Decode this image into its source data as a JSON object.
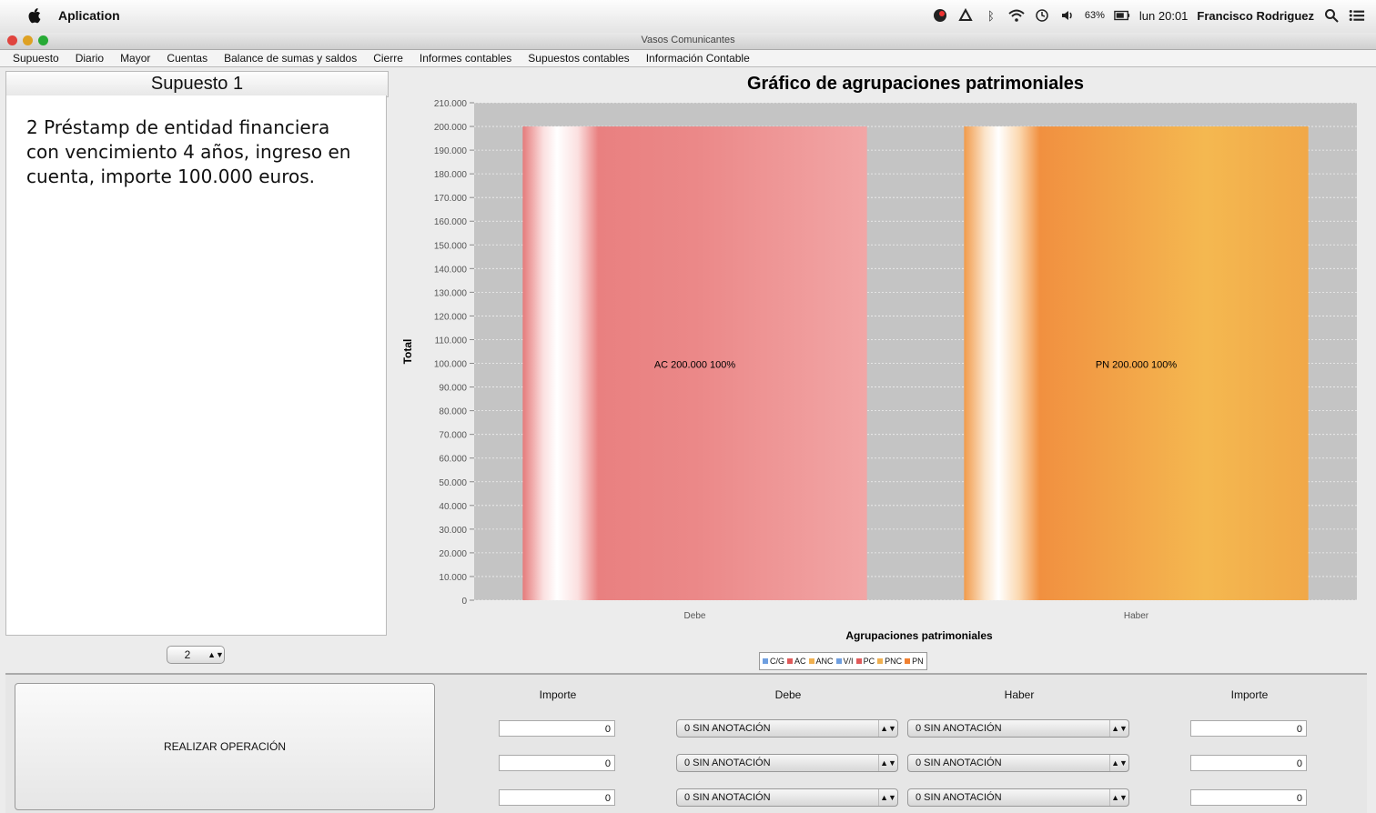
{
  "menubar": {
    "app_name": "Aplication",
    "battery": "63%",
    "clock": "lun 20:01",
    "user": "Francisco Rodriguez"
  },
  "window": {
    "title": "Vasos Comunicantes"
  },
  "menu": [
    "Supuesto",
    "Diario",
    "Mayor",
    "Cuentas",
    "Balance de sumas y saldos",
    "Cierre",
    "Informes contables",
    "Supuestos contables",
    "Información Contable"
  ],
  "left_panel": {
    "title": "Supuesto 1",
    "text": "2 Préstamp de entidad financiera con vencimiento 4  años, ingreso en cuenta, importe 100.000 euros.",
    "stepper_value": "2"
  },
  "chart_data": {
    "type": "bar",
    "title": "Gráfico de agrupaciones patrimoniales",
    "xlabel": "Agrupaciones patrimoniales",
    "ylabel": "Total",
    "categories": [
      "Debe",
      "Haber"
    ],
    "ylim": [
      0,
      210000
    ],
    "ytick_labels": [
      "0",
      "10.000",
      "20.000",
      "30.000",
      "40.000",
      "50.000",
      "60.000",
      "70.000",
      "80.000",
      "90.000",
      "100.000",
      "110.000",
      "120.000",
      "130.000",
      "140.000",
      "150.000",
      "160.000",
      "170.000",
      "180.000",
      "190.000",
      "200.000",
      "210.000"
    ],
    "series": [
      {
        "name": "AC",
        "category": "Debe",
        "value": 200000,
        "label": "AC 200.000 100%",
        "color": "#e98080"
      },
      {
        "name": "PN",
        "category": "Haber",
        "value": 200000,
        "label": "PN 200.000 100%",
        "color": "#f0a040"
      }
    ],
    "grid": true,
    "legend_position": "bottom",
    "legend": [
      {
        "name": "C/G",
        "color": "#6f9fe0"
      },
      {
        "name": "AC",
        "color": "#e05a5a"
      },
      {
        "name": "ANC",
        "color": "#f0b050"
      },
      {
        "name": "V/I",
        "color": "#6f9fe0"
      },
      {
        "name": "PC",
        "color": "#e05a5a"
      },
      {
        "name": "PNC",
        "color": "#f0b050"
      },
      {
        "name": "PN",
        "color": "#f08030"
      }
    ]
  },
  "operation": {
    "button_label": "REALIZAR OPERACIÓN",
    "headers": {
      "importe_left": "Importe",
      "debe": "Debe",
      "haber": "Haber",
      "importe_right": "Importe"
    },
    "rows": [
      {
        "importe_debe": "0",
        "debe": "0 SIN ANOTACIÓN",
        "haber": "0 SIN ANOTACIÓN",
        "importe_haber": "0"
      },
      {
        "importe_debe": "0",
        "debe": "0 SIN ANOTACIÓN",
        "haber": "0 SIN ANOTACIÓN",
        "importe_haber": "0"
      },
      {
        "importe_debe": "0",
        "debe": "0 SIN ANOTACIÓN",
        "haber": "0 SIN ANOTACIÓN",
        "importe_haber": "0"
      }
    ]
  }
}
